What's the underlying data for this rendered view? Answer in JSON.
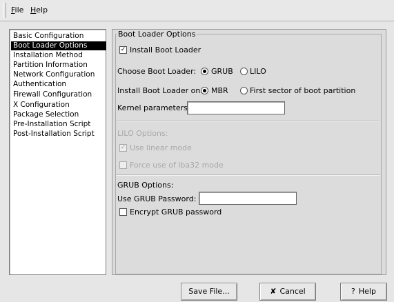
{
  "menu": {
    "file": "File",
    "help": "Help"
  },
  "sidebar": {
    "items": [
      {
        "label": "Basic Configuration"
      },
      {
        "label": "Boot Loader Options"
      },
      {
        "label": "Installation Method"
      },
      {
        "label": "Partition Information"
      },
      {
        "label": "Network Configuration"
      },
      {
        "label": "Authentication"
      },
      {
        "label": "Firewall Configuration"
      },
      {
        "label": "X Configuration"
      },
      {
        "label": "Package Selection"
      },
      {
        "label": "Pre-Installation Script"
      },
      {
        "label": "Post-Installation Script"
      }
    ],
    "selected": "Boot Loader Options"
  },
  "boot": {
    "group_title": "Boot Loader Options",
    "install_label": "Install Boot Loader",
    "install_checked": true,
    "choose_label": "Choose Boot Loader:",
    "grub_label": "GRUB",
    "lilo_label": "LILO",
    "selected_loader": "GRUB",
    "install_on_label": "Install Boot Loader on:",
    "mbr_label": "MBR",
    "first_sector_label": "First sector of boot partition",
    "selected_location": "MBR",
    "kernel_label": "Kernel parameters:",
    "kernel_value": ""
  },
  "lilo": {
    "title": "LILO Options:",
    "linear_label": "Use linear mode",
    "linear_checked": true,
    "lba32_label": "Force use of lba32 mode",
    "lba32_checked": false
  },
  "grub": {
    "title": "GRUB Options:",
    "password_label": "Use GRUB Password:",
    "password_value": "",
    "encrypt_label": "Encrypt GRUB password",
    "encrypt_checked": false
  },
  "buttons": {
    "save": "Save File...",
    "cancel": "Cancel",
    "help": "Help",
    "cancel_icon": "x-icon",
    "help_icon": "question-icon"
  }
}
